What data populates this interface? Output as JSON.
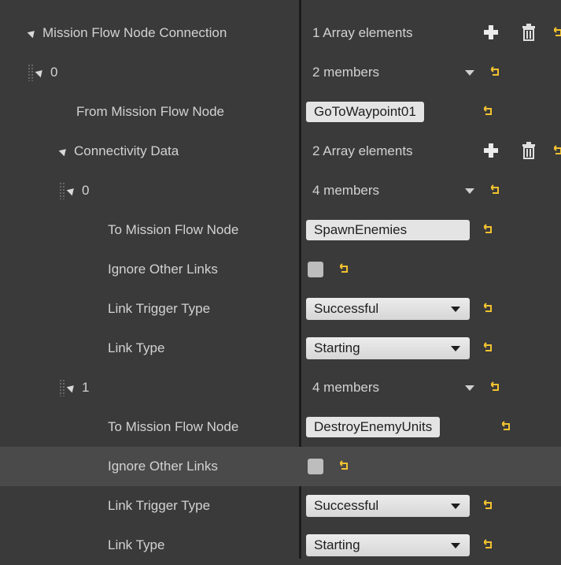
{
  "colors": {
    "background": "#3a3a3a",
    "highlight_row": "#4a4a4a",
    "reset_arrow": "#f2c230"
  },
  "rows": [
    {
      "label": "Mission Flow Node Connection",
      "value": "1 Array elements",
      "icons": [
        "plus-icon",
        "trash-icon",
        "reset-arrow-icon"
      ]
    },
    {
      "label": "0",
      "value": "2 members",
      "icons": [
        "dropdown-caret-icon",
        "reset-arrow-icon"
      ]
    },
    {
      "label": "From Mission Flow Node",
      "value": "GoToWaypoint01",
      "icons": [
        "reset-arrow-icon"
      ]
    },
    {
      "label": "Connectivity Data",
      "value": "2 Array elements",
      "icons": [
        "plus-icon",
        "trash-icon",
        "reset-arrow-icon"
      ]
    },
    {
      "label": "0",
      "value": "4 members",
      "icons": [
        "dropdown-caret-icon",
        "reset-arrow-icon"
      ]
    },
    {
      "label": "To Mission Flow Node",
      "value": "SpawnEnemies",
      "icons": [
        "reset-arrow-icon"
      ]
    },
    {
      "label": "Ignore Other Links",
      "value": "",
      "icons": [
        "checkbox",
        "reset-arrow-icon"
      ]
    },
    {
      "label": "Link Trigger Type",
      "value": "Successful",
      "icons": [
        "chevron-down-icon",
        "reset-arrow-icon"
      ]
    },
    {
      "label": "Link Type",
      "value": "Starting",
      "icons": [
        "chevron-down-icon",
        "reset-arrow-icon"
      ]
    },
    {
      "label": "1",
      "value": "4 members",
      "icons": [
        "dropdown-caret-icon",
        "reset-arrow-icon"
      ]
    },
    {
      "label": "To Mission Flow Node",
      "value": "DestroyEnemyUnits",
      "icons": [
        "reset-arrow-icon"
      ]
    },
    {
      "label": "Ignore Other Links",
      "value": "",
      "icons": [
        "checkbox",
        "reset-arrow-icon"
      ]
    },
    {
      "label": "Link Trigger Type",
      "value": "Successful",
      "icons": [
        "chevron-down-icon",
        "reset-arrow-icon"
      ]
    },
    {
      "label": "Link Type",
      "value": "Starting",
      "icons": [
        "chevron-down-icon",
        "reset-arrow-icon"
      ]
    }
  ]
}
